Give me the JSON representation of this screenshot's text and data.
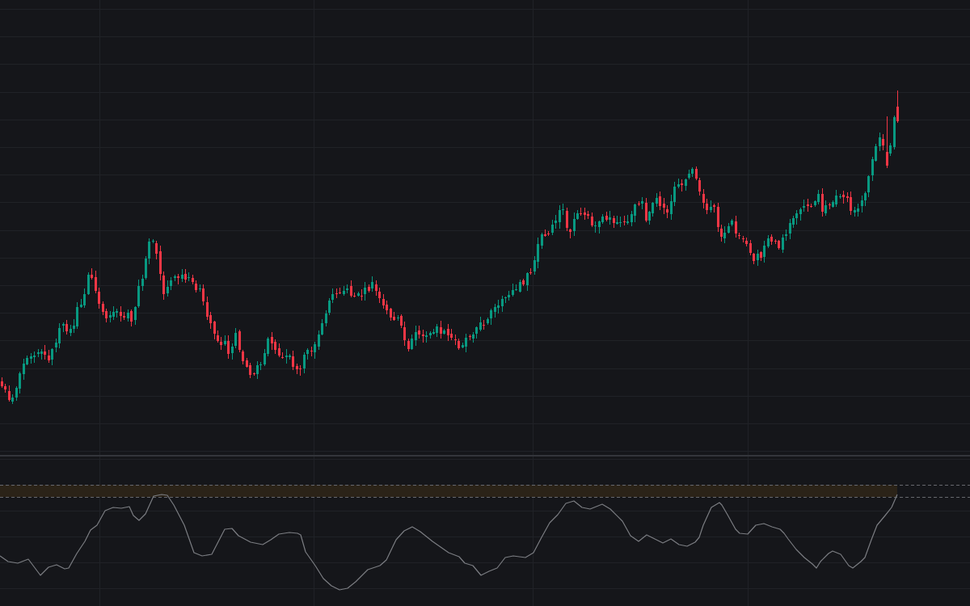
{
  "panes": [
    {
      "kind": "candlestick",
      "candle_series": [
        {
          "kind": "rising",
          "color": "#089981"
        },
        {
          "kind": "falling",
          "color": "#f23645"
        }
      ]
    },
    {
      "kind": "oscillator"
    }
  ]
}
